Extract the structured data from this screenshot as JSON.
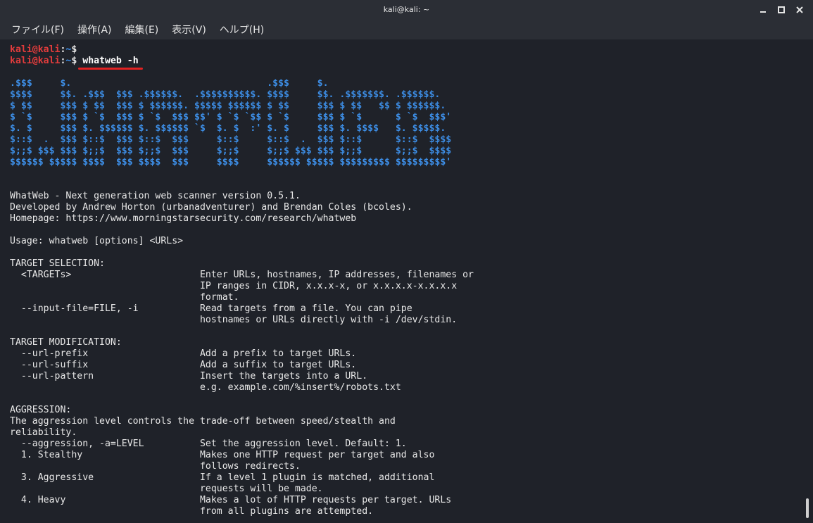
{
  "window": {
    "title": "kali@kali: ~",
    "controls": [
      "minimize-icon",
      "maximize-icon",
      "close-icon"
    ]
  },
  "menubar": {
    "items": [
      "ファイル(F)",
      "操作(A)",
      "編集(E)",
      "表示(V)",
      "ヘルプ(H)"
    ]
  },
  "prompt": {
    "user_host": "kali@kali",
    "separator": ":",
    "path": "~",
    "symbol": "$"
  },
  "command": "whatweb -h",
  "ascii_art": [
    ".$$$     $.                                   .$$$     $.",
    "$$$$     $$. .$$$  $$$ .$$$$$$.  .$$$$$$$$$$. $$$$     $$. .$$$$$$$. .$$$$$$.",
    "$ $$     $$$ $ $$  $$$ $ $$$$$$. $$$$$ $$$$$$ $ $$     $$$ $ $$   $$ $ $$$$$$.",
    "$ `$     $$$ $ `$  $$$ $ `$  $$$ $$' $ `$ `$$ $ `$     $$$ $ `$      $ `$  $$$'",
    "$. $     $$$ $. $$$$$$ $. $$$$$$ `$  $. $  :' $. $     $$$ $. $$$$   $. $$$$$.",
    "$::$  .  $$$ $::$  $$$ $::$  $$$     $::$     $::$  .  $$$ $::$      $::$  $$$$",
    "$;;$ $$$ $$$ $;;$  $$$ $;;$  $$$     $;;$     $;;$ $$$ $$$ $;;$      $;;$  $$$$",
    "$$$$$$ $$$$$ $$$$  $$$ $$$$  $$$     $$$$     $$$$$$ $$$$$ $$$$$$$$$ $$$$$$$$$'"
  ],
  "output_lines": [
    "",
    "",
    "WhatWeb - Next generation web scanner version 0.5.1.",
    "Developed by Andrew Horton (urbanadventurer) and Brendan Coles (bcoles).",
    "Homepage: https://www.morningstarsecurity.com/research/whatweb",
    "",
    "Usage: whatweb [options] <URLs>",
    "",
    "TARGET SELECTION:",
    "  <TARGETs>                       Enter URLs, hostnames, IP addresses, filenames or",
    "                                  IP ranges in CIDR, x.x.x-x, or x.x.x.x-x.x.x.x",
    "                                  format.",
    "  --input-file=FILE, -i           Read targets from a file. You can pipe",
    "                                  hostnames or URLs directly with -i /dev/stdin.",
    "",
    "TARGET MODIFICATION:",
    "  --url-prefix                    Add a prefix to target URLs.",
    "  --url-suffix                    Add a suffix to target URLs.",
    "  --url-pattern                   Insert the targets into a URL.",
    "                                  e.g. example.com/%insert%/robots.txt",
    "",
    "AGGRESSION:",
    "The aggression level controls the trade-off between speed/stealth and",
    "reliability.",
    "  --aggression, -a=LEVEL          Set the aggression level. Default: 1.",
    "  1. Stealthy                     Makes one HTTP request per target and also",
    "                                  follows redirects.",
    "  3. Aggressive                   If a level 1 plugin is matched, additional",
    "                                  requests will be made.",
    "  4. Heavy                        Makes a lot of HTTP requests per target. URLs",
    "                                  from all plugins are attempted."
  ],
  "colors": {
    "background": "#1f2229",
    "titlebar": "#2b2e35",
    "prompt_user": "#e23c3c",
    "prompt_path": "#3b8eea",
    "ascii_art": "#3d8ee6",
    "underline": "#e32222"
  }
}
